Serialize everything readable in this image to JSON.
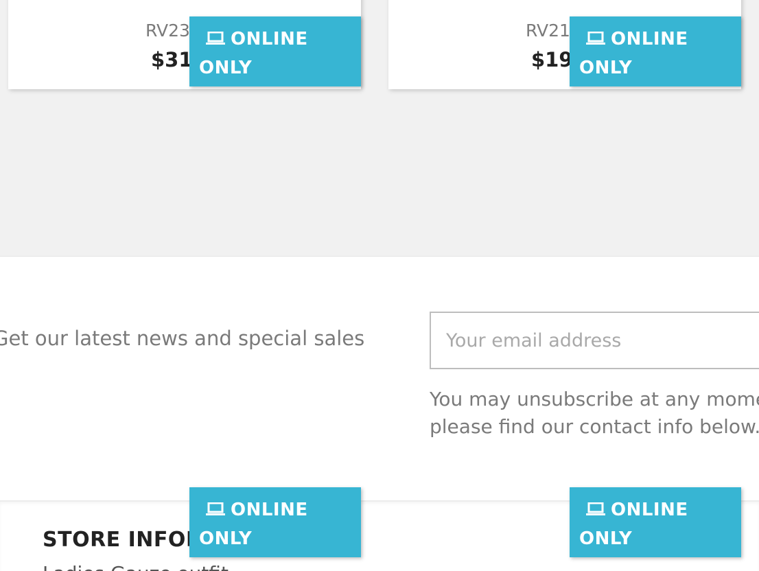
{
  "products": [
    {
      "reference": "RV23",
      "price": "$31."
    },
    {
      "reference": "RV21",
      "price": "$19."
    }
  ],
  "flag": {
    "icon": "laptop-icon",
    "line1": "ONLINE",
    "line2": "ONLY",
    "color": "#37b5d3"
  },
  "newsletter": {
    "text": "Get our latest news and special sales",
    "email_placeholder": "Your email address",
    "unsubscribe_line1": "You may unsubscribe at any mome",
    "unsubscribe_line2": "please find our contact info below."
  },
  "footer": {
    "store_info_title": "STORE INFOR",
    "store_info_line": "Ladies Gauze outfit"
  }
}
